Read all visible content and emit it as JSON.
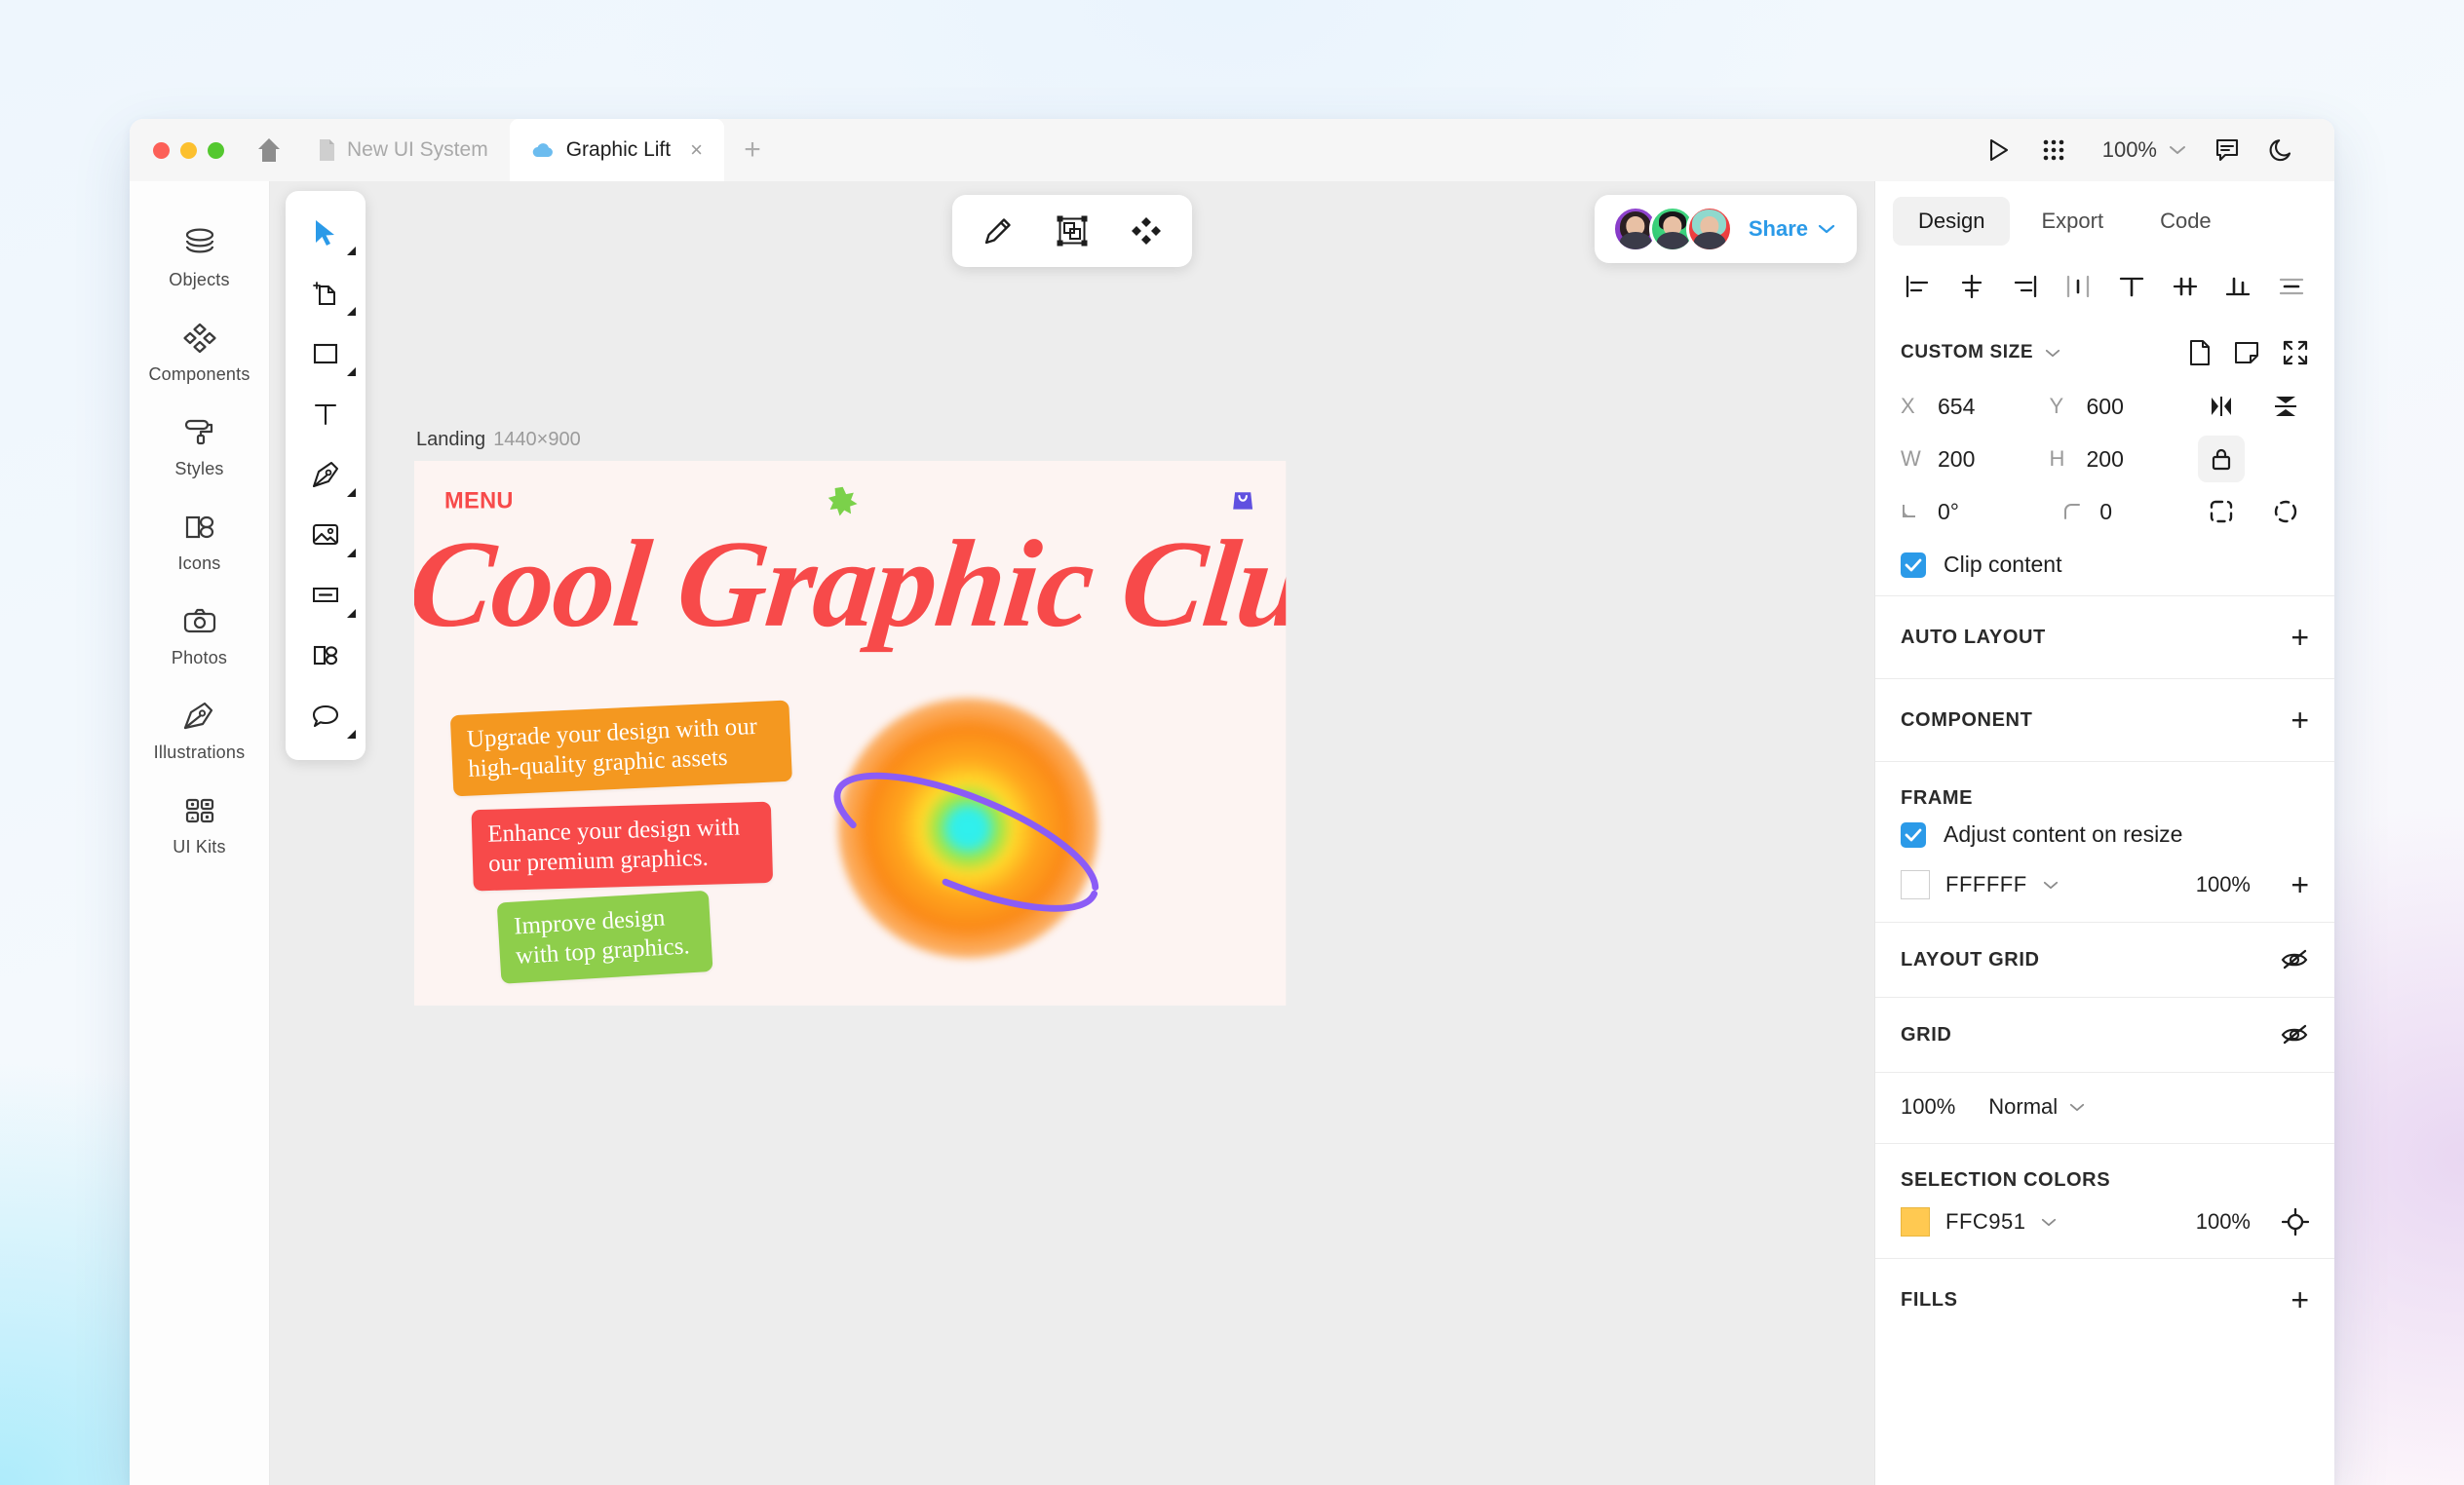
{
  "window": {
    "traffic_lights": [
      "close",
      "minimize",
      "maximize"
    ],
    "home_icon": "home-icon",
    "tabs": [
      {
        "label": "New UI System",
        "icon": "file-icon",
        "active": false
      },
      {
        "label": "Graphic Lift",
        "icon": "cloud-icon",
        "active": true,
        "close": "×"
      }
    ],
    "new_tab_label": "+",
    "right_controls": {
      "play_icon": "play-icon",
      "grid_icon": "apps-grid-icon",
      "zoom_value": "100%",
      "zoom_chevron": "chevron-down-icon",
      "comment_icon": "comment-icon",
      "theme_icon": "moon-icon"
    }
  },
  "rail": {
    "items": [
      {
        "label": "Objects",
        "icon": "layers-icon"
      },
      {
        "label": "Components",
        "icon": "components-diamond-icon"
      },
      {
        "label": "Styles",
        "icon": "paint-roller-icon"
      },
      {
        "label": "Icons",
        "icon": "icons-shapes-icon"
      },
      {
        "label": "Photos",
        "icon": "camera-icon"
      },
      {
        "label": "Illustrations",
        "icon": "pen-nib-icon"
      },
      {
        "label": "UI Kits",
        "icon": "ui-kits-grid-icon"
      }
    ]
  },
  "tool_palette": {
    "tools": [
      {
        "name": "move-tool",
        "icon": "cursor-arrow-icon",
        "active": true,
        "has_flyout": true
      },
      {
        "name": "artboard-tool",
        "icon": "artboard-icon",
        "active": false,
        "has_flyout": true
      },
      {
        "name": "rectangle-tool",
        "icon": "rectangle-icon",
        "active": false,
        "has_flyout": true
      },
      {
        "name": "text-tool",
        "icon": "text-t-icon",
        "active": false,
        "has_flyout": false
      },
      {
        "name": "pen-tool",
        "icon": "pen-nib-icon",
        "active": false,
        "has_flyout": true
      },
      {
        "name": "image-tool",
        "icon": "image-icon",
        "active": false,
        "has_flyout": true
      },
      {
        "name": "button-tool",
        "icon": "button-icon",
        "active": false,
        "has_flyout": true
      },
      {
        "name": "mask-tool",
        "icon": "mask-shapes-icon",
        "active": false,
        "has_flyout": false
      },
      {
        "name": "comment-tool",
        "icon": "speech-bubble-icon",
        "active": false,
        "has_flyout": true
      }
    ]
  },
  "float_toolbar": {
    "buttons": [
      {
        "name": "pencil-tool",
        "icon": "pencil-icon"
      },
      {
        "name": "boolean-tool",
        "icon": "boolean-frame-icon"
      },
      {
        "name": "components-tool",
        "icon": "components-diamond-icon"
      }
    ]
  },
  "share": {
    "collaborators": [
      "avatar-1",
      "avatar-2",
      "avatar-3"
    ],
    "label": "Share",
    "chevron": "chevron-down-icon"
  },
  "frame": {
    "name": "Landing",
    "dimensions": "1440×900",
    "content": {
      "menu_word": "MENU",
      "star_icon": "star-8-point-icon",
      "bag_icon": "shopping-bag-icon",
      "headline": "Cool Graphic Club",
      "badges": [
        {
          "text": "Upgrade your design with our high-quality graphic assets",
          "color": "#F49820"
        },
        {
          "text": "Enhance your design with our premium graphics.",
          "color": "#F74A4A"
        },
        {
          "text": "Improve design with top graphics.",
          "color": "#8ECE4B"
        }
      ],
      "planet": {
        "name": "planet-graphic",
        "ring_color": "#8B5CF6"
      }
    }
  },
  "right_panel": {
    "tabs": [
      {
        "label": "Design",
        "active": true
      },
      {
        "label": "Export",
        "active": false
      },
      {
        "label": "Code",
        "active": false
      }
    ],
    "align_icons": [
      "align-left-icon",
      "align-horizontal-center-icon",
      "align-right-icon",
      "distribute-horizontal-icon",
      "align-top-icon",
      "align-vertical-center-icon",
      "align-bottom-icon",
      "distribute-vertical-icon"
    ],
    "size_section": {
      "title": "CUSTOM SIZE",
      "chevron": "chevron-down-icon",
      "actions": [
        "page-icon",
        "sticky-note-icon",
        "expand-icon"
      ],
      "x_label": "X",
      "x_value": "654",
      "y_label": "Y",
      "y_value": "600",
      "w_label": "W",
      "w_value": "200",
      "h_label": "H",
      "h_value": "200",
      "rotation_label": "angle-icon",
      "rotation_value": "0°",
      "radius_label": "corner-radius-icon",
      "radius_value": "0",
      "flip_h_icon": "flip-horizontal-icon",
      "flip_v_icon": "flip-vertical-icon",
      "lock_icon": "lock-icon",
      "constrain_icons": [
        "constrain-dashed-icon",
        "constrain-round-icon"
      ],
      "clip_content_label": "Clip content",
      "clip_content_checked": true
    },
    "auto_layout": {
      "title": "AUTO LAYOUT",
      "add": "+"
    },
    "component": {
      "title": "COMPONENT",
      "add": "+"
    },
    "frame_section": {
      "title": "FRAME",
      "adjust_label": "Adjust content on resize",
      "adjust_checked": true,
      "fill_hex": "FFFFFF",
      "fill_opacity": "100%",
      "fill_add": "+"
    },
    "layout_grid": {
      "title": "LAYOUT GRID",
      "visibility_icon": "eye-off-icon"
    },
    "grid": {
      "title": "GRID",
      "visibility_icon": "eye-off-icon"
    },
    "blend": {
      "opacity": "100%",
      "mode": "Normal",
      "chevron": "chevron-down-icon"
    },
    "selection_colors": {
      "title": "SELECTION COLORS",
      "hex": "FFC951",
      "opacity": "100%",
      "target_icon": "target-icon",
      "chevron": "chevron-down-icon"
    },
    "fills": {
      "title": "FILLS",
      "add": "+"
    }
  }
}
